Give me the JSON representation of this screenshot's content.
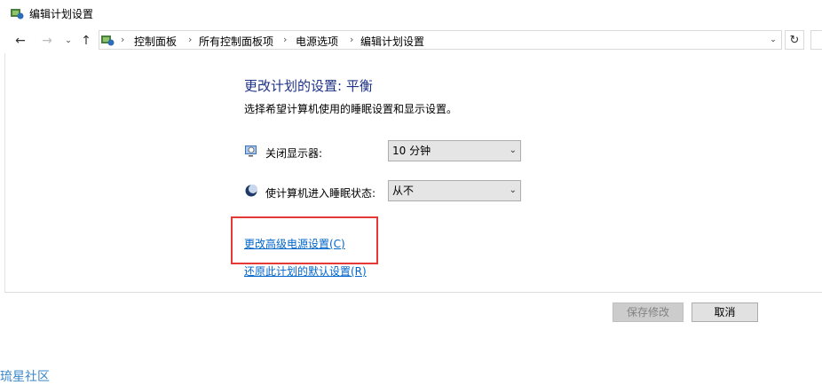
{
  "window": {
    "title": "编辑计划设置"
  },
  "nav": {
    "breadcrumbs": [
      "控制面板",
      "所有控制面板项",
      "电源选项",
      "编辑计划设置"
    ]
  },
  "main": {
    "heading": "更改计划的设置: 平衡",
    "subtitle": "选择希望计算机使用的睡眠设置和显示设置。",
    "display_off": {
      "label": "关闭显示器:",
      "value": "10 分钟"
    },
    "sleep": {
      "label": "使计算机进入睡眠状态:",
      "value": "从不"
    },
    "advanced_link": "更改高级电源设置(C)",
    "restore_link": "还原此计划的默认设置(R)"
  },
  "footer": {
    "save_label": "保存修改",
    "cancel_label": "取消"
  },
  "watermark": "琉星社区",
  "colors": {
    "highlight": "#e53935",
    "link": "#0066cc",
    "heading": "#1e3287"
  }
}
